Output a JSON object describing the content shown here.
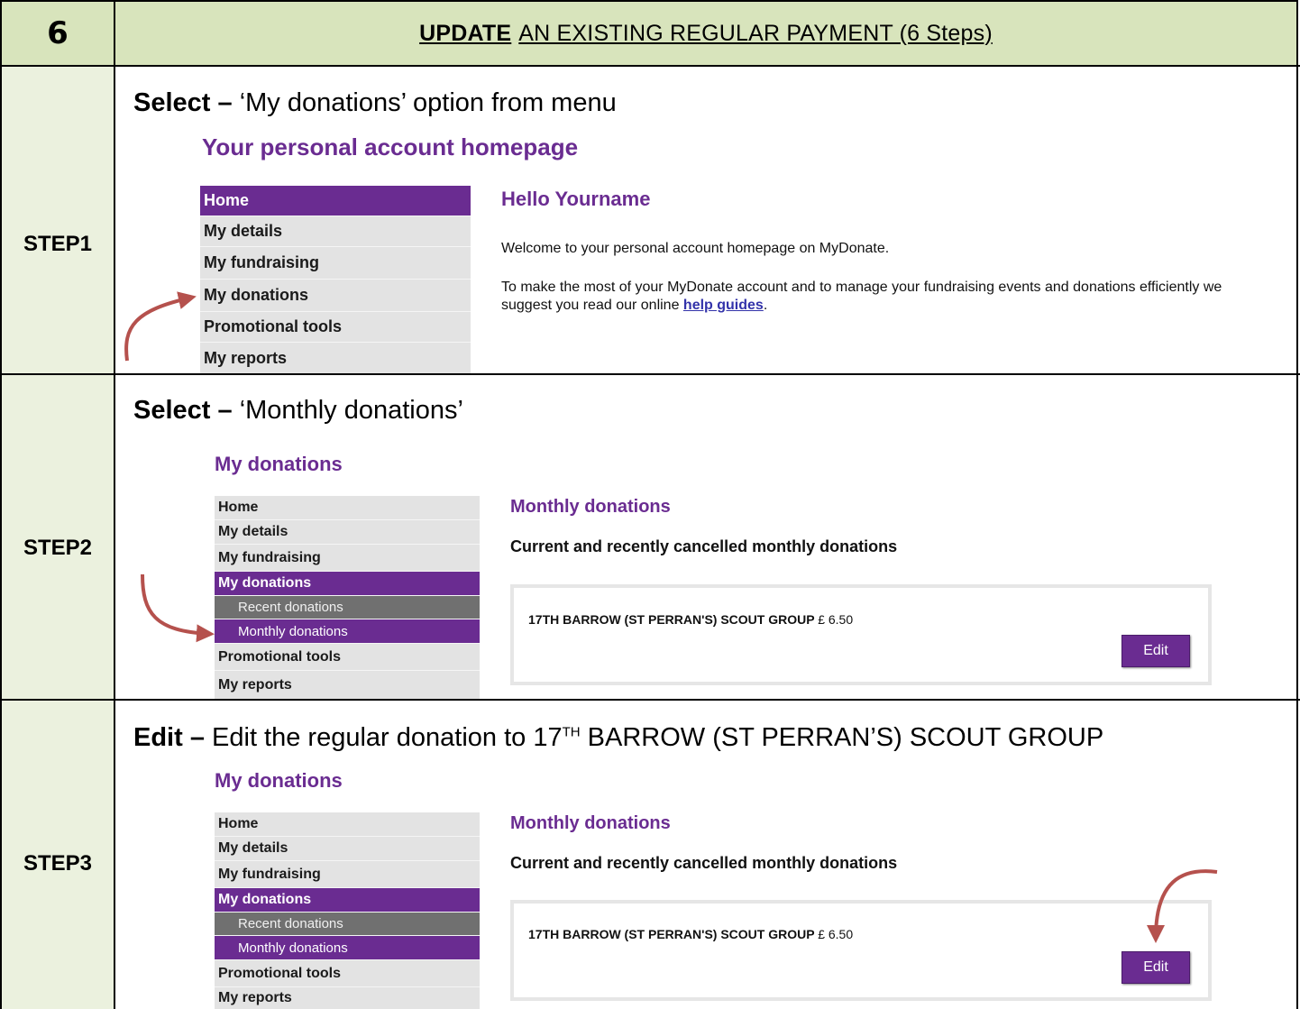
{
  "header": {
    "number": "6",
    "title_bold": "UPDATE",
    "title_rest": "AN EXISTING REGULAR PAYMENT (6 Steps)"
  },
  "steps": [
    {
      "label": "STEP1",
      "instruction_bold": "Select –",
      "instruction_text": " ‘My donations’ option from menu",
      "page_title": "Your personal account homepage",
      "menu": [
        "Home",
        "My details",
        "My fundraising",
        "My donations",
        "Promotional tools",
        "My reports"
      ],
      "greeting": "Hello Yourname",
      "welcome": "Welcome to your personal account homepage on MyDonate.",
      "tip_text": "To make the most of your MyDonate account and to manage your fundraising events and donations efficiently we suggest you read our online ",
      "tip_link": "help guides",
      "tip_end": "."
    },
    {
      "label": "STEP2",
      "instruction_bold": "Select –",
      "instruction_text": " ‘Monthly donations’",
      "page_title": "My donations",
      "menu": [
        "Home",
        "My details",
        "My fundraising",
        "My donations",
        "Recent donations",
        "Monthly donations",
        "Promotional tools",
        "My reports"
      ],
      "section_title": "Monthly donations",
      "section_sub": "Current and recently cancelled monthly donations",
      "donation_name": "17TH BARROW (ST PERRAN'S) SCOUT GROUP",
      "donation_amount": "£ 6.50",
      "edit_label": "Edit"
    },
    {
      "label": "STEP3",
      "instruction_bold": "Edit –",
      "instruction_pre": " Edit the regular donation to 17",
      "instruction_sup": "TH",
      "instruction_post": " BARROW (ST PERRAN’S) SCOUT GROUP",
      "page_title": "My donations",
      "menu": [
        "Home",
        "My details",
        "My fundraising",
        "My donations",
        "Recent donations",
        "Monthly donations",
        "Promotional tools",
        "My reports"
      ],
      "section_title": "Monthly donations",
      "section_sub": "Current and recently cancelled monthly donations",
      "donation_name": "17TH BARROW (ST PERRAN'S) SCOUT GROUP",
      "donation_amount": "£ 6.50",
      "edit_label": "Edit"
    }
  ],
  "colors": {
    "header_bg": "#d8e4bc",
    "step_cell_bg": "#ebf1de",
    "brand_purple": "#6a2c91",
    "arrow_color": "#b5514d"
  },
  "icons": [
    "curved-arrow-icon"
  ]
}
